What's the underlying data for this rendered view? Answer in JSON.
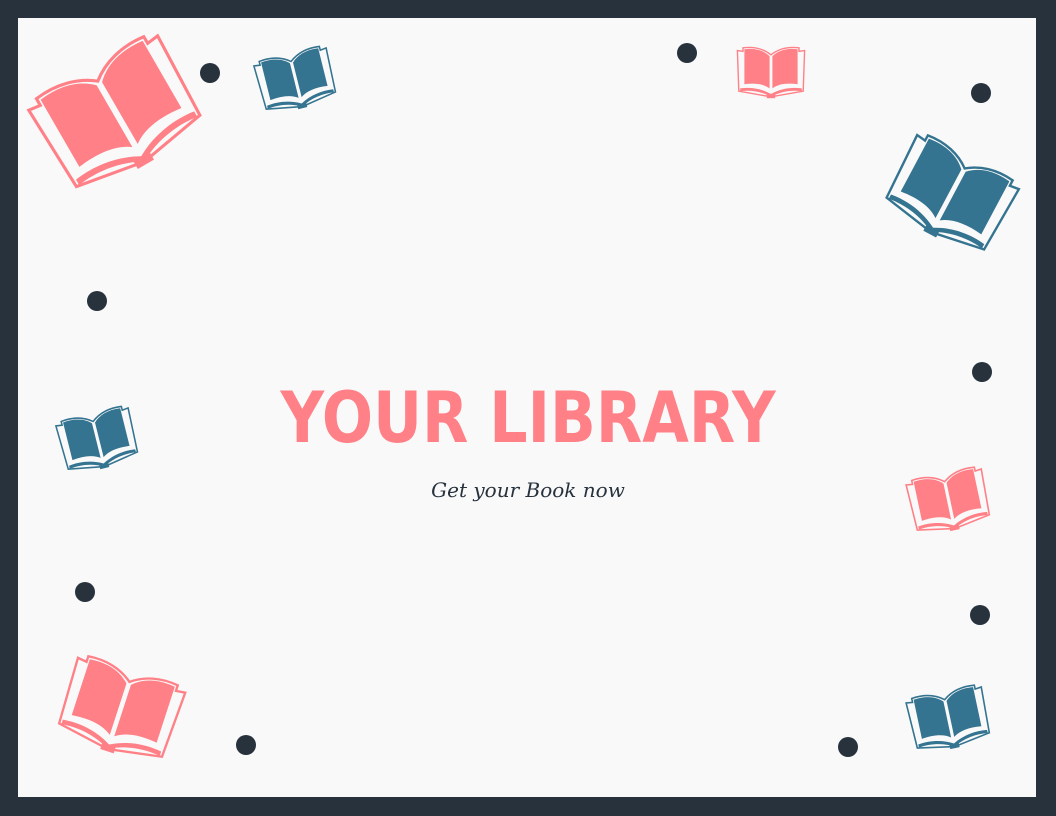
{
  "poster": {
    "title": "YOUR LIBRARY",
    "subtitle": "Get your Book now"
  },
  "colors": {
    "frame": "#27323d",
    "background": "#f9f9f9",
    "accent_pink": "#ff8087",
    "accent_blue": "#357491",
    "dot": "#27323d",
    "subtitle_text": "#27323d"
  },
  "decorations": {
    "book_icon": "open-book-icon",
    "dot_icon": "dot"
  }
}
